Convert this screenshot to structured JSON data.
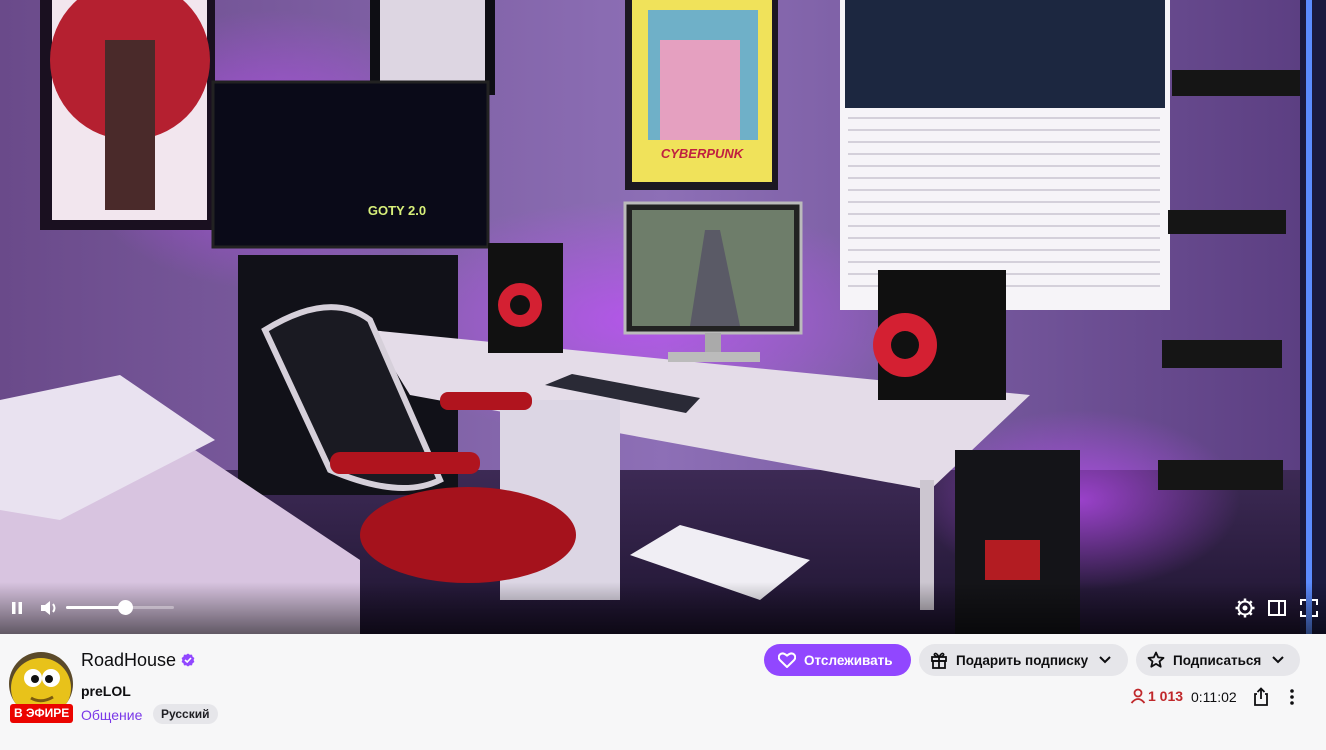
{
  "player": {
    "screen_text": "GOTY 2.0",
    "poster_text": "CYBERPUNK",
    "volume_level": 0.55,
    "icons": {
      "pause": "pause-icon",
      "volume": "volume-icon",
      "settings": "gear-icon",
      "theatre": "theatre-mode-icon",
      "fullscreen": "fullscreen-icon"
    }
  },
  "channel": {
    "name": "RoadHouse",
    "verified": true,
    "live_badge": "В ЭФИРЕ",
    "stream_title": "preLOL",
    "category": "Общение",
    "tags": [
      "Русский"
    ]
  },
  "actions": {
    "follow_label": "Отслеживать",
    "gift_label": "Подарить подписку",
    "subscribe_label": "Подписаться"
  },
  "stats": {
    "viewers": "1 013",
    "uptime": "0:11:02"
  },
  "colors": {
    "accent": "#9147ff",
    "live": "#eb0400",
    "viewers": "#c0282b",
    "category": "#7a38e8"
  }
}
